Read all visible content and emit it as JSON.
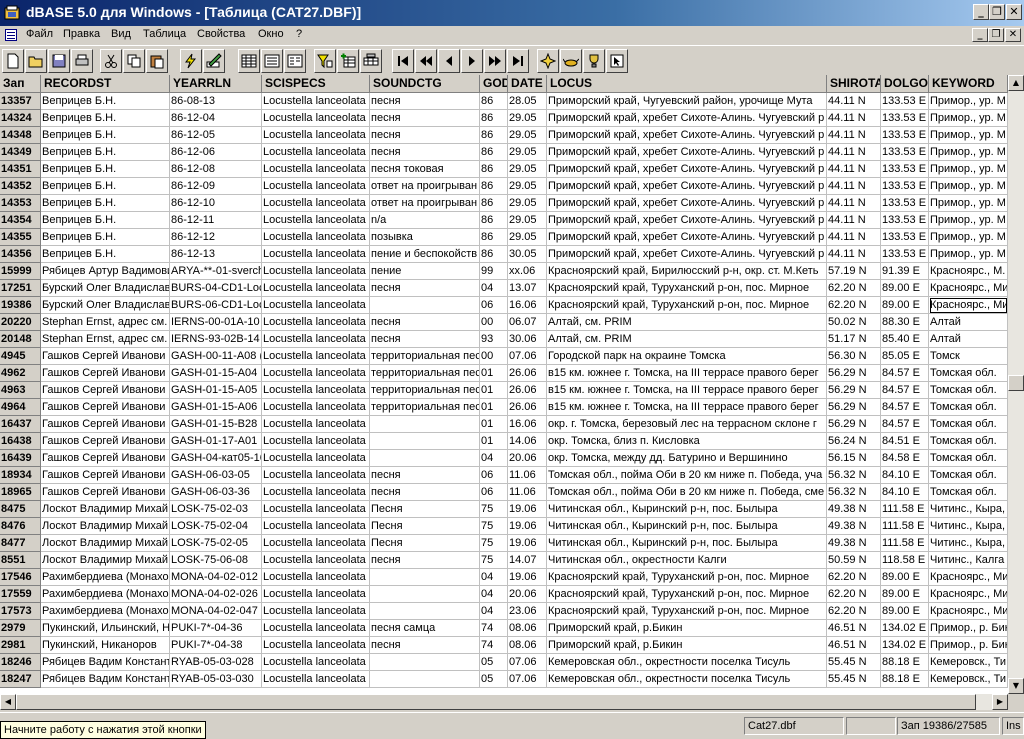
{
  "window": {
    "title": "dBASE 5.0 для Windows - [Таблица (CAT27.DBF)]"
  },
  "menu": [
    "Файл",
    "Правка",
    "Вид",
    "Таблица",
    "Свойства",
    "Окно",
    "?"
  ],
  "columns": [
    "Зап",
    "RECORDST",
    "YEARRLN",
    "SCISPECS",
    "SOUNDCTG",
    "GOD",
    "DATE",
    "LOCUS",
    "SHIROTA",
    "DOLGOT",
    "KEYWORD"
  ],
  "rows": [
    [
      "13357",
      "Веприцев Б.Н.",
      "86-08-13",
      "Locustella lanceolata",
      "песня",
      "86",
      "28.05",
      "Приморский край, Чугуевский район, урочище Мута",
      "44.11 N",
      "133.53 E",
      "Примор., ур. М"
    ],
    [
      "14324",
      "Веприцев Б.Н.",
      "86-12-04",
      "Locustella lanceolata",
      "песня",
      "86",
      "29.05",
      "Приморский край, хребет Сихоте-Алинь. Чугуевский р",
      "44.11 N",
      "133.53 E",
      "Примор., ур. М"
    ],
    [
      "14348",
      "Веприцев Б.Н.",
      "86-12-05",
      "Locustella lanceolata",
      "песня",
      "86",
      "29.05",
      "Приморский край, хребет Сихоте-Алинь. Чугуевский р",
      "44.11 N",
      "133.53 E",
      "Примор., ур. М"
    ],
    [
      "14349",
      "Веприцев Б.Н.",
      "86-12-06",
      "Locustella lanceolata",
      "песня",
      "86",
      "29.05",
      "Приморский край, хребет Сихоте-Алинь. Чугуевский р",
      "44.11 N",
      "133.53 E",
      "Примор., ур. М"
    ],
    [
      "14351",
      "Веприцев Б.Н.",
      "86-12-08",
      "Locustella lanceolata",
      "песня токовая",
      "86",
      "29.05",
      "Приморский край, хребет Сихоте-Алинь. Чугуевский р",
      "44.11 N",
      "133.53 E",
      "Примор., ур. М"
    ],
    [
      "14352",
      "Веприцев Б.Н.",
      "86-12-09",
      "Locustella lanceolata",
      "ответ на проигрыван",
      "86",
      "29.05",
      "Приморский край, хребет Сихоте-Алинь. Чугуевский р",
      "44.11 N",
      "133.53 E",
      "Примор., ур. М"
    ],
    [
      "14353",
      "Веприцев Б.Н.",
      "86-12-10",
      "Locustella lanceolata",
      "ответ на проигрыван",
      "86",
      "29.05",
      "Приморский край, хребет Сихоте-Алинь. Чугуевский р",
      "44.11 N",
      "133.53 E",
      "Примор., ур. М"
    ],
    [
      "14354",
      "Веприцев Б.Н.",
      "86-12-11",
      "Locustella lanceolata",
      "n/a",
      "86",
      "29.05",
      "Приморский край, хребет Сихоте-Алинь. Чугуевский р",
      "44.11 N",
      "133.53 E",
      "Примор., ур. М"
    ],
    [
      "14355",
      "Веприцев Б.Н.",
      "86-12-12",
      "Locustella lanceolata",
      "позывка",
      "86",
      "29.05",
      "Приморский край, хребет Сихоте-Алинь. Чугуевский р",
      "44.11 N",
      "133.53 E",
      "Примор., ур. М"
    ],
    [
      "14356",
      "Веприцев Б.Н.",
      "86-12-13",
      "Locustella lanceolata",
      "пение и беспокойств",
      "86",
      "30.05",
      "Приморский край, хребет Сихоте-Алинь. Чугуевский р",
      "44.11 N",
      "133.53 E",
      "Примор., ур. М"
    ],
    [
      "15999",
      "Рябицев Артур Вадимови",
      "ARYA-**-01-sverch",
      "Locustella lanceolata",
      "пение",
      "99",
      "xx.06",
      "Красноярский край, Бирилюсский р-н, окр. ст. М.Кеть",
      "57.19 N",
      "91.39 E",
      "Красноярс., М."
    ],
    [
      "17251",
      "Бурский Олег Владислав",
      "BURS-04-CD1-Loc",
      "Locustella lanceolata",
      "песня",
      "04",
      "13.07",
      "Красноярский край, Туруханский р-он, пос. Мирное",
      "62.20 N",
      "89.00 E",
      "Красноярс., Ми"
    ],
    [
      "19386",
      "Бурский Олег Владислав",
      "BURS-06-CD1-Loc",
      "Locustella lanceolata",
      "",
      "06",
      "16.06",
      "Красноярский край, Туруханский р-он, пос. Мирное",
      "62.20 N",
      "89.00 E",
      "Красноярс., Ми"
    ],
    [
      "20220",
      "Stephan Ernst, адрес см.",
      "IERNS-00-01A-10",
      "Locustella lanceolata",
      "песня",
      "00",
      "06.07",
      "Алтай, см. PRIM",
      "50.02 N",
      "88.30 E",
      "Алтай"
    ],
    [
      "20148",
      "Stephan Ernst, адрес см.",
      "IERNS-93-02B-14",
      "Locustella lanceolata",
      "песня",
      "93",
      "30.06",
      "Алтай, см. PRIM",
      "51.17 N",
      "85.40 E",
      "Алтай"
    ],
    [
      "4945",
      "Гашков Сергей Иванови",
      "GASH-00-11-A08 (",
      "Locustella lanceolata",
      "территориальная пес",
      "00",
      "07.06",
      "Городской парк на окраине Томска",
      "56.30 N",
      "85.05 E",
      "Томск"
    ],
    [
      "4962",
      "Гашков Сергей Иванови",
      "GASH-01-15-A04",
      "Locustella lanceolata",
      "территориальная пес",
      "01",
      "26.06",
      "в15 км. южнее г. Томска, на III террасе правого берег",
      "56.29 N",
      "84.57 E",
      "Томская обл."
    ],
    [
      "4963",
      "Гашков Сергей Иванови",
      "GASH-01-15-A05",
      "Locustella lanceolata",
      "территориальная пес",
      "01",
      "26.06",
      "в15 км. южнее г. Томска, на III террасе правого берег",
      "56.29 N",
      "84.57 E",
      "Томская обл."
    ],
    [
      "4964",
      "Гашков Сергей Иванови",
      "GASH-01-15-A06",
      "Locustella lanceolata",
      "территориальная пес",
      "01",
      "26.06",
      "в15 км. южнее г. Томска, на III террасе правого берег",
      "56.29 N",
      "84.57 E",
      "Томская обл."
    ],
    [
      "16437",
      "Гашков Сергей Иванови",
      "GASH-01-15-B28",
      "Locustella lanceolata",
      "",
      "01",
      "16.06",
      "окр. г. Томска, березовый лес на террасном склоне г",
      "56.29 N",
      "84.57 E",
      "Томская обл."
    ],
    [
      "16438",
      "Гашков Сергей Иванови",
      "GASH-01-17-A01",
      "Locustella lanceolata",
      "",
      "01",
      "14.06",
      "окр. Томска, близ п. Кисловка",
      "56.24 N",
      "84.51 E",
      "Томская обл."
    ],
    [
      "16439",
      "Гашков Сергей Иванови",
      "GASH-04-кат05-16",
      "Locustella lanceolata",
      "",
      "04",
      "20.06",
      "окр. Томска, между дд. Батурино и Вершинино",
      "56.15 N",
      "84.58 E",
      "Томская обл."
    ],
    [
      "18934",
      "Гашков Сергей Иванови",
      "GASH-06-03-05",
      "Locustella lanceolata",
      "песня",
      "06",
      "11.06",
      "Томская обл., пойма Оби в 20 км ниже п. Победа, уча",
      "56.32 N",
      "84.10 E",
      "Томская обл."
    ],
    [
      "18965",
      "Гашков Сергей Иванови",
      "GASH-06-03-36",
      "Locustella lanceolata",
      "песня",
      "06",
      "11.06",
      "Томская обл., пойма Оби в 20 км ниже п. Победа, сме",
      "56.32 N",
      "84.10 E",
      "Томская обл."
    ],
    [
      "8475",
      "Лоскот Владимир Михай",
      "LOSK-75-02-03",
      "Locustella lanceolata",
      "Песня",
      "75",
      "19.06",
      "Читинская обл., Кыринский р-н, пос. Былыра",
      "49.38 N",
      "111.58 E",
      "Читинс., Кыра,"
    ],
    [
      "8476",
      "Лоскот Владимир Михай",
      "LOSK-75-02-04",
      "Locustella lanceolata",
      "Песня",
      "75",
      "19.06",
      "Читинская обл., Кыринский р-н, пос. Былыра",
      "49.38 N",
      "111.58 E",
      "Читинс., Кыра,"
    ],
    [
      "8477",
      "Лоскот Владимир Михай",
      "LOSK-75-02-05",
      "Locustella lanceolata",
      "Песня",
      "75",
      "19.06",
      "Читинская обл., Кыринский р-н, пос. Былыра",
      "49.38 N",
      "111.58 E",
      "Читинс., Кыра,"
    ],
    [
      "8551",
      "Лоскот Владимир Михай",
      "LOSK-75-06-08",
      "Locustella lanceolata",
      "песня",
      "75",
      "14.07",
      "Читинская обл., окрестности Калги",
      "50.59 N",
      "118.58 E",
      "Читинс., Калга"
    ],
    [
      "17546",
      "Рахимбердиева (Монахов",
      "MONA-04-02-012",
      "Locustella lanceolata",
      "",
      "04",
      "19.06",
      "Красноярский край, Туруханский р-он, пос. Мирное",
      "62.20 N",
      "89.00 E",
      "Красноярс., Ми"
    ],
    [
      "17559",
      "Рахимбердиева (Монахов",
      "MONA-04-02-026",
      "Locustella lanceolata",
      "",
      "04",
      "20.06",
      "Красноярский край, Туруханский р-он, пос. Мирное",
      "62.20 N",
      "89.00 E",
      "Красноярс., Ми"
    ],
    [
      "17573",
      "Рахимбердиева (Монахов",
      "MONA-04-02-047",
      "Locustella lanceolata",
      "",
      "04",
      "23.06",
      "Красноярский край, Туруханский р-он, пос. Мирное",
      "62.20 N",
      "89.00 E",
      "Красноярс., Ми"
    ],
    [
      "2979",
      "Пукинский, Ильинский, Н",
      "PUKI-7*-04-36",
      "Locustella lanceolata",
      "песня самца",
      "74",
      "08.06",
      "Приморский край, р.Бикин",
      "46.51 N",
      "134.02 E",
      "Примор., р. Бик"
    ],
    [
      "2981",
      "Пукинский, Никаноров",
      "PUKI-7*-04-38",
      "Locustella lanceolata",
      "песня",
      "74",
      "08.06",
      "Приморский край, р.Бикин",
      "46.51 N",
      "134.02 E",
      "Примор., р. Бик"
    ],
    [
      "18246",
      "Рябицев Вадим Констант",
      "RYAB-05-03-028",
      "Locustella lanceolata",
      "",
      "05",
      "07.06",
      "Кемеровская обл., окрестности поселка Тисуль",
      "55.45 N",
      "88.18 E",
      "Кемеровск., Ти"
    ],
    [
      "18247",
      "Рябицев Вадим Констант",
      "RYAB-05-03-030",
      "Locustella lanceolata",
      "",
      "05",
      "07.06",
      "Кемеровская обл., окрестности поселка Тисуль",
      "55.45 N",
      "88.18 E",
      "Кемеровск., Ти"
    ]
  ],
  "status": {
    "tooltip": "Начните работу с нажатия этой кнопки",
    "file": "Cat27.dbf",
    "record": "Зап 19386/27585",
    "mode": "Ins"
  }
}
